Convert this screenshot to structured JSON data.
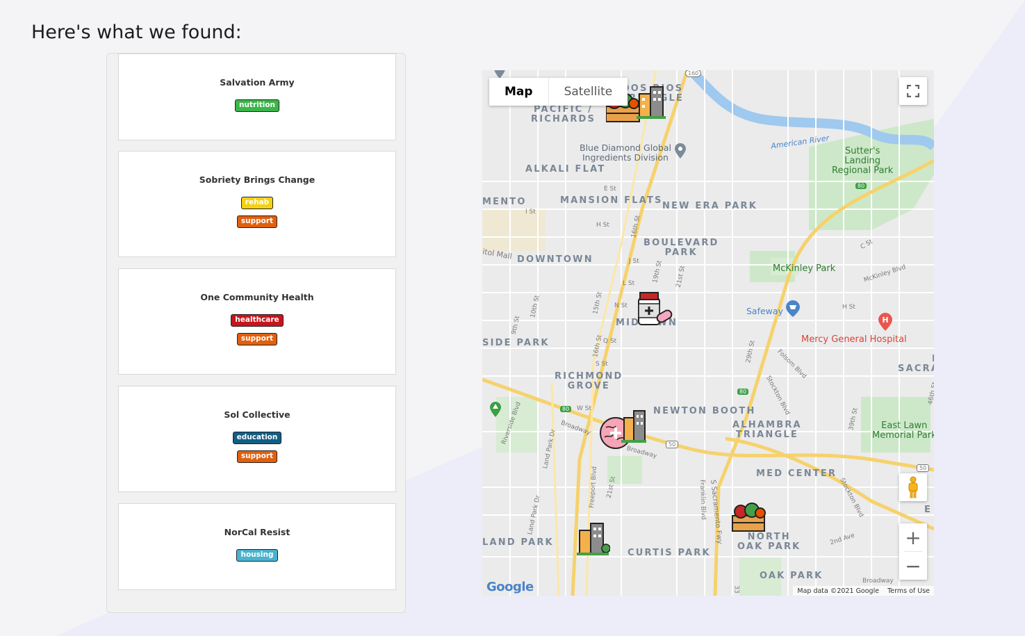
{
  "page": {
    "heading": "Here's what we found:"
  },
  "colors": {
    "nutrition": "#3cb54a",
    "rehab": "#f3d214",
    "support": "#e0600f",
    "healthcare": "#c9141b",
    "education": "#125e85",
    "housing": "#4ab2cf"
  },
  "results": [
    {
      "name": "Salvation Army",
      "tags": [
        {
          "label": "nutrition",
          "color": "#3cb54a"
        }
      ]
    },
    {
      "name": "Sobriety Brings Change",
      "tags": [
        {
          "label": "rehab",
          "color": "#f3d214"
        },
        {
          "label": "support",
          "color": "#e0600f"
        }
      ]
    },
    {
      "name": "One Community Health",
      "tags": [
        {
          "label": "healthcare",
          "color": "#c9141b"
        },
        {
          "label": "support",
          "color": "#e0600f"
        }
      ]
    },
    {
      "name": "Sol Collective",
      "tags": [
        {
          "label": "education",
          "color": "#125e85"
        },
        {
          "label": "support",
          "color": "#e0600f"
        }
      ]
    },
    {
      "name": "NorCal Resist",
      "tags": [
        {
          "label": "housing",
          "color": "#4ab2cf"
        }
      ]
    }
  ],
  "map": {
    "type_map": "Map",
    "type_satellite": "Satellite",
    "attribution": "Map data ©2021 Google",
    "terms": "Terms of Use",
    "google_logo": "Google",
    "fullscreen_icon": "fullscreen-icon",
    "zoom_in": "+",
    "zoom_out": "−",
    "pegman_icon": "pegman-icon",
    "labels": {
      "pacific_richards": "PACIFIC /\nRICHARDS",
      "dos_rios": "DOS RIOS\nTRIANGLE",
      "blue_diamond": "Blue Diamond Global\nIngredients Division",
      "alkali_flat": "ALKALI FLAT",
      "american_river": "American River",
      "sutters_landing": "Sutter's\nLanding\nRegional Park",
      "mento": "MENTO",
      "mansion_flats": "MANSION FLATS",
      "new_era_park": "NEW ERA PARK",
      "boulevard_park": "BOULEVARD\nPARK",
      "capitol_mall": "itol Mall",
      "downtown": "DOWNTOWN",
      "mckinley_park": "McKinley Park",
      "safeway": "Safeway",
      "midtown": "MIDTOWN",
      "mercy_general": "Mercy General Hospital",
      "side_park": "SIDE PARK",
      "richmond_grove": "RICHMOND\nGROVE",
      "east_sacra": "E\nSACRA",
      "newton_booth": "NEWTON BOOTH",
      "alhambra_triangle": "ALHAMBRA\nTRIANGLE",
      "east_lawn": "East Lawn\nMemorial Park",
      "med_center": "MED CENTER",
      "land_park": "LAND PARK",
      "curtis_park": "CURTIS PARK",
      "north_oak_park": "NORTH\nOAK PARK",
      "oak_park": "OAK PARK",
      "e_edge": "E",
      "broadway": "Broadway",
      "broadway2": "Broadway",
      "broadway3": "Broadway",
      "e_st": "E St",
      "h_st": "H St",
      "j_st": "J St",
      "l_st": "L St",
      "n_st": "N St",
      "q_st": "Q St",
      "s_st": "S St",
      "w_st": "W St",
      "i_st": "I St",
      "c_st": "C St",
      "h_st2": "H St",
      "st16": "16th St",
      "st15": "15th St",
      "st16b": "16th St",
      "st19": "19th St",
      "st21": "21st St",
      "st29": "29th St",
      "st10": "10th St",
      "st9": "9th St",
      "st21b": "21st St",
      "st39": "39th St",
      "st46": "46th St",
      "mckinley_blvd": "McKinley Blvd",
      "folsom_blvd": "Folsom Blvd",
      "stockton_blvd": "Stockton Blvd",
      "stockton_blvd2": "Stockton Blvd",
      "riverside_blvd": "Riverside Blvd",
      "land_park_dr": "Land Park Dr",
      "land_park_dr2": "Land Park Dr",
      "freeport_blvd": "Freeport Blvd",
      "franklin_blvd": "Franklin Blvd",
      "sacramento_fwy": "S Sacramento Fwy",
      "second_ave": "2nd Ave",
      "st33": "33",
      "hwy160": "160",
      "hwy80": "80",
      "hwy80b": "80",
      "hwy80c": "80",
      "hwy50": "50",
      "hwy50b": "50"
    }
  }
}
